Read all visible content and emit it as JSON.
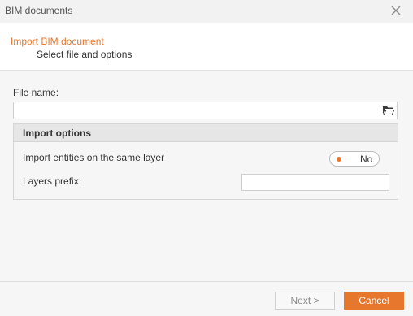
{
  "window": {
    "title": "BIM documents"
  },
  "header": {
    "title": "Import  BIM document",
    "subtitle": "Select file and options"
  },
  "file": {
    "label": "File name:",
    "value": "",
    "placeholder": ""
  },
  "options": {
    "heading": "Import options",
    "same_layer_label": "Import entities on the same layer",
    "same_layer_value": "No",
    "prefix_label": "Layers prefix:",
    "prefix_value": ""
  },
  "buttons": {
    "next": "Next >",
    "cancel": "Cancel"
  },
  "colors": {
    "accent": "#e8772e"
  }
}
